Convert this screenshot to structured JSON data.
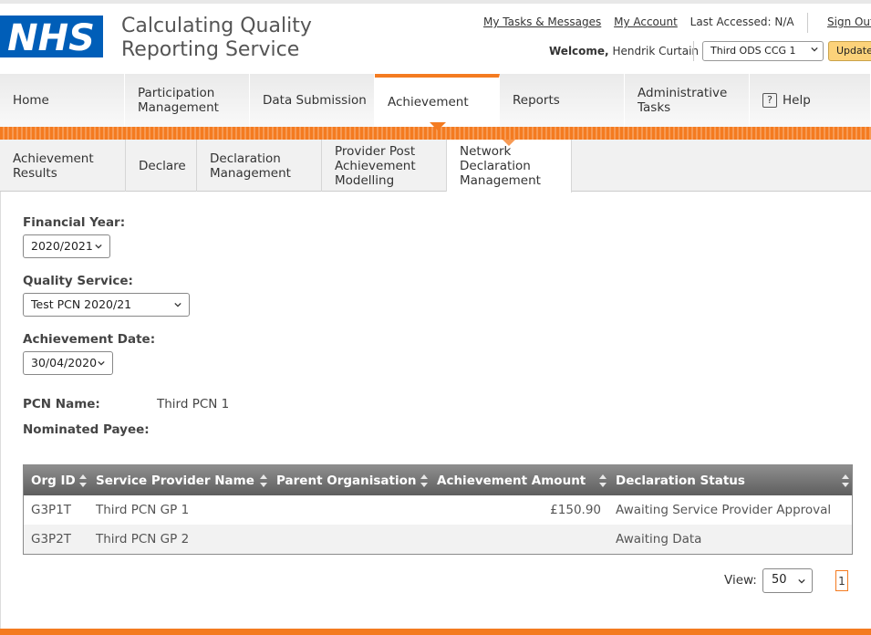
{
  "header": {
    "logo_text": "NHS",
    "title_line1": "Calculating Quality",
    "title_line2": "Reporting Service",
    "links": {
      "tasks": "My Tasks & Messages",
      "account": "My Account",
      "last_accessed": "Last Accessed: N/A",
      "sign_out": "Sign Out"
    },
    "welcome_label": "Welcome,",
    "welcome_user": "Hendrik Curtain",
    "org_select_value": "Third ODS CCG 1",
    "update_label": "Update"
  },
  "main_nav": [
    {
      "label": "Home"
    },
    {
      "label": "Participation Management"
    },
    {
      "label": "Data Submission"
    },
    {
      "label": "Achievement"
    },
    {
      "label": "Reports"
    },
    {
      "label": "Administrative Tasks"
    },
    {
      "label": "Help",
      "icon": "?"
    }
  ],
  "sub_nav": [
    {
      "label": "Achievement Results"
    },
    {
      "label": "Declare"
    },
    {
      "label": "Declaration Management"
    },
    {
      "label": "Provider Post Achievement Modelling"
    },
    {
      "label": "Network Declaration Management"
    }
  ],
  "form": {
    "financial_year_label": "Financial Year:",
    "financial_year_value": "2020/2021",
    "quality_service_label": "Quality Service:",
    "quality_service_value": "Test PCN 2020/21",
    "achievement_date_label": "Achievement Date:",
    "achievement_date_value": "30/04/2020"
  },
  "info": {
    "pcn_name_label": "PCN Name:",
    "pcn_name_value": "Third PCN 1",
    "nominated_payee_label": "Nominated Payee:"
  },
  "grid": {
    "columns": [
      "Org ID",
      "Service Provider Name",
      "Parent Organisation",
      "Achievement Amount",
      "Declaration Status"
    ],
    "rows": [
      {
        "org_id": "G3P1T",
        "provider": "Third PCN GP 1",
        "parent": "",
        "amount": "£150.90",
        "status": "Awaiting Service Provider Approval"
      },
      {
        "org_id": "G3P2T",
        "provider": "Third PCN GP 2",
        "parent": "",
        "amount": "",
        "status": "Awaiting Data"
      }
    ]
  },
  "pager": {
    "view_label": "View:",
    "view_value": "50",
    "page": "1"
  },
  "colors": {
    "nhs_blue": "#005eb8",
    "accent_orange": "#f47b20",
    "update_button": "#fcd27a",
    "grid_header": "#6e6e6e"
  }
}
